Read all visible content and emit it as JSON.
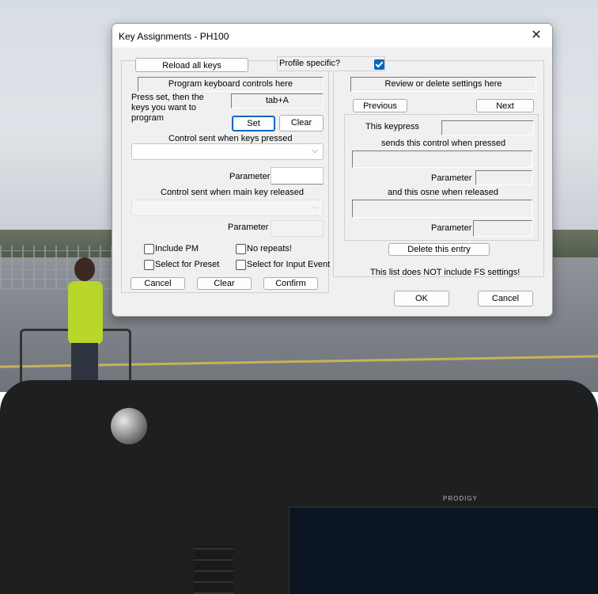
{
  "dialog": {
    "title": "Key Assignments - PH100",
    "close_glyph": "✕"
  },
  "top": {
    "reload_label": "Reload all keys",
    "profile_specific_label": "Profile specific?",
    "profile_specific_checked": true
  },
  "left": {
    "header": "Program keyboard controls here",
    "instructions": "Press set, then the keys you want to program",
    "keys_value": "tab+A",
    "set_label": "Set",
    "clear_label": "Clear",
    "control_pressed_label": "Control sent when keys pressed",
    "control_pressed_value": "",
    "parameter_label": "Parameter",
    "parameter_value": "",
    "control_released_label": "Control sent when main key released",
    "control_released_value": "",
    "parameter2_label": "Parameter",
    "parameter2_value": "",
    "include_pm_label": "Include PM",
    "no_repeats_label": "No repeats!",
    "select_preset_label": "Select for Preset",
    "select_input_event_label": "Select for Input Event",
    "cancel_label": "Cancel",
    "clear2_label": "Clear",
    "confirm_label": "Confirm"
  },
  "right": {
    "header": "Review or delete settings here",
    "previous_label": "Previous",
    "next_label": "Next",
    "this_keypress_label": "This keypress",
    "this_keypress_value": "",
    "sends_label": "sends this control when pressed",
    "sends_value": "",
    "parameter_label": "Parameter",
    "parameter_value": "",
    "released_label": "and this osne when released",
    "released_value": "",
    "parameter2_label": "Parameter",
    "parameter2_value": "",
    "delete_label": "Delete this entry",
    "note": "This list does NOT include FS settings!",
    "ok_label": "OK",
    "cancel_label": "Cancel"
  },
  "background": {
    "brand_text": "PRODIGY"
  },
  "colors": {
    "accent": "#0067c0",
    "dialog_bg": "#f0f0f0"
  },
  "icons": {
    "close": "close-icon",
    "dropdown": "chevron-down-icon",
    "check": "checkmark-icon"
  }
}
